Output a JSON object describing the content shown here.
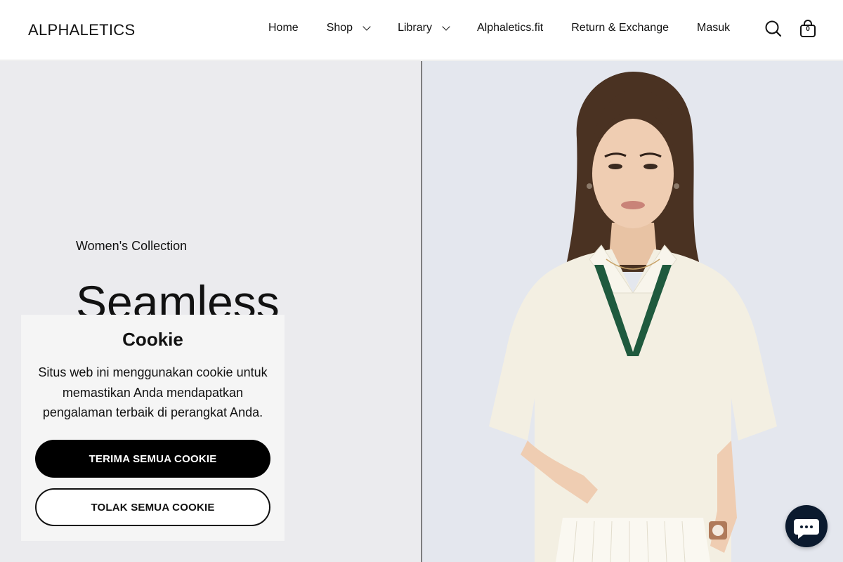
{
  "header": {
    "logo": "ALPHALETICS",
    "nav": [
      {
        "label": "Home",
        "dropdown": false
      },
      {
        "label": "Shop",
        "dropdown": true
      },
      {
        "label": "Library",
        "dropdown": true
      },
      {
        "label": "Alphaletics.fit",
        "dropdown": false
      },
      {
        "label": "Return & Exchange",
        "dropdown": false
      },
      {
        "label": "Masuk",
        "dropdown": false
      }
    ],
    "search_icon": "search-icon",
    "cart_icon": "shopping-bag-icon",
    "cart_count": "0"
  },
  "hero": {
    "eyebrow": "Women's Collection",
    "title": "Seamless Wear",
    "left_bg": "#ebebee",
    "right_bg": "#e4e7ee",
    "image_alt": "woman in white polo shirt with green v-neck trim and pleated skirt"
  },
  "cookie": {
    "title": "Cookie",
    "text": "Situs web ini menggunakan cookie untuk memastikan Anda mendapatkan pengalaman terbaik di perangkat Anda.",
    "accept_label": "TERIMA SEMUA COOKIE",
    "reject_label": "TOLAK SEMUA COOKIE"
  },
  "chat": {
    "icon": "chat-bubble-icon",
    "color": "#0b1a2e"
  }
}
